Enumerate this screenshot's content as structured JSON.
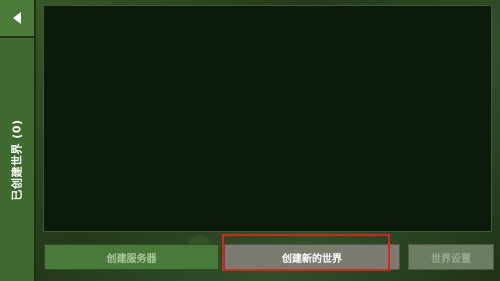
{
  "sidebar": {
    "back_icon": "back-arrow-icon",
    "tab_label": "已创建世界 (0)"
  },
  "buttons": {
    "create_server": "创建服务器",
    "create_new_world": "创建新的世界",
    "world_settings": "世界设置"
  },
  "colors": {
    "highlight": "#e0201a",
    "sidebar": "#3f6a2f"
  }
}
